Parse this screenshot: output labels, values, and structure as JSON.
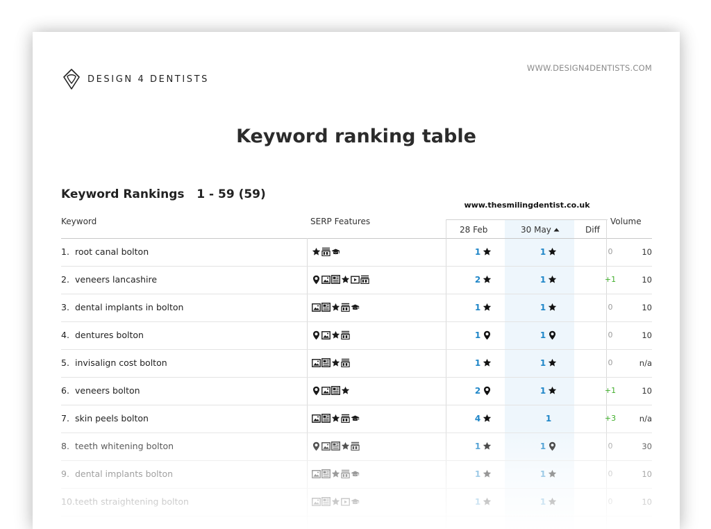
{
  "brand": {
    "name": "DESIGN 4 DENTISTS",
    "url": "WWW.DESIGN4DENTISTS.COM"
  },
  "title": "Keyword ranking table",
  "subtitle": "Keyword Rankings   1 - 59 (59)",
  "domain": "www.thesmilingdentist.co.uk",
  "columns": {
    "keyword": "Keyword",
    "serp": "SERP Features",
    "feb": "28 Feb",
    "may": "30 May",
    "diff": "Diff",
    "volume": "Volume"
  },
  "colors": {
    "rank": "#1f86c8",
    "positive": "#3fae2a",
    "neutral": "#9a9a9a",
    "highlight": "#eef6fc"
  },
  "rows": [
    {
      "num": "1.",
      "keyword": "root canal bolton",
      "serp": [
        "star-icon",
        "ad-icon",
        "graduation-cap-icon"
      ],
      "feb": "1",
      "feb_icon": "star-icon",
      "may": "1",
      "may_icon": "star-icon",
      "diff": "0",
      "volume": "10"
    },
    {
      "num": "2.",
      "keyword": "veneers lancashire",
      "serp": [
        "pin-icon",
        "image-icon",
        "news-icon",
        "star-icon",
        "video-icon",
        "ad-icon"
      ],
      "feb": "2",
      "feb_icon": "star-icon",
      "may": "1",
      "may_icon": "star-icon",
      "diff": "+1",
      "volume": "10"
    },
    {
      "num": "3.",
      "keyword": "dental implants in bolton",
      "serp": [
        "image-icon",
        "news-icon",
        "star-icon",
        "ad-icon",
        "graduation-cap-icon"
      ],
      "feb": "1",
      "feb_icon": "star-icon",
      "may": "1",
      "may_icon": "star-icon",
      "diff": "0",
      "volume": "10"
    },
    {
      "num": "4.",
      "keyword": "dentures bolton",
      "serp": [
        "pin-icon",
        "image-icon",
        "star-icon",
        "ad-icon"
      ],
      "feb": "1",
      "feb_icon": "pin-icon",
      "may": "1",
      "may_icon": "pin-icon",
      "diff": "0",
      "volume": "10"
    },
    {
      "num": "5.",
      "keyword": "invisalign cost  bolton",
      "serp": [
        "image-icon",
        "news-icon",
        "star-icon",
        "ad-icon"
      ],
      "feb": "1",
      "feb_icon": "star-icon",
      "may": "1",
      "may_icon": "star-icon",
      "diff": "0",
      "volume": "n/a"
    },
    {
      "num": "6.",
      "keyword": "veneers bolton",
      "serp": [
        "pin-icon",
        "image-icon",
        "news-icon",
        "star-icon"
      ],
      "feb": "2",
      "feb_icon": "pin-icon",
      "may": "1",
      "may_icon": "star-icon",
      "diff": "+1",
      "volume": "10"
    },
    {
      "num": "7.",
      "keyword": "skin peels bolton",
      "serp": [
        "image-icon",
        "news-icon",
        "star-icon",
        "ad-icon",
        "graduation-cap-icon"
      ],
      "feb": "4",
      "feb_icon": "star-icon",
      "may": "1",
      "may_icon": "",
      "diff": "+3",
      "volume": "n/a"
    },
    {
      "num": "8.",
      "keyword": "teeth whitening bolton",
      "serp": [
        "pin-icon",
        "image-icon",
        "news-icon",
        "star-icon",
        "ad-icon"
      ],
      "feb": "1",
      "feb_icon": "star-icon",
      "may": "1",
      "may_icon": "pin-icon",
      "diff": "0",
      "volume": "30"
    },
    {
      "num": "9.",
      "keyword": "dental implants bolton",
      "serp": [
        "image-icon",
        "news-icon",
        "star-icon",
        "ad-icon",
        "graduation-cap-icon"
      ],
      "feb": "1",
      "feb_icon": "star-icon",
      "may": "1",
      "may_icon": "star-icon",
      "diff": "0",
      "volume": "10"
    },
    {
      "num": "10.",
      "keyword": "teeth straightening bolton",
      "serp": [
        "image-icon",
        "news-icon",
        "star-icon",
        "video-icon",
        "graduation-cap-icon"
      ],
      "feb": "1",
      "feb_icon": "star-icon",
      "may": "1",
      "may_icon": "star-icon",
      "diff": "0",
      "volume": "10"
    }
  ]
}
